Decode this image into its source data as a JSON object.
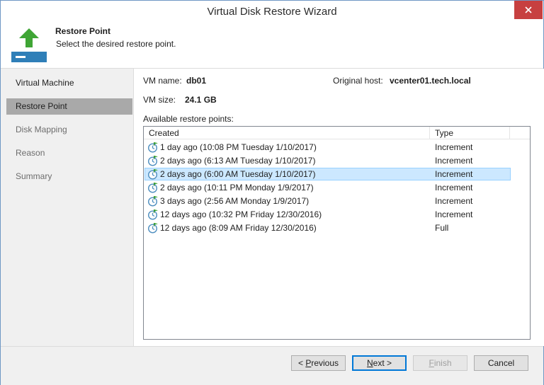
{
  "window": {
    "title": "Virtual Disk Restore Wizard"
  },
  "header": {
    "title": "Restore Point",
    "subtitle": "Select the desired restore point.",
    "icon": "restore-arrow-icon"
  },
  "steps": [
    {
      "label": "Virtual Machine",
      "state": "done"
    },
    {
      "label": "Restore Point",
      "state": "active"
    },
    {
      "label": "Disk Mapping",
      "state": "pending"
    },
    {
      "label": "Reason",
      "state": "pending"
    },
    {
      "label": "Summary",
      "state": "pending"
    }
  ],
  "vm": {
    "name_label": "VM name:",
    "name_value": "db01",
    "host_label": "Original host:",
    "host_value": "vcenter01.tech.local",
    "size_label": "VM size:",
    "size_value": "24.1 GB"
  },
  "restore_points": {
    "label": "Available restore points:",
    "columns": {
      "created": "Created",
      "type": "Type"
    },
    "rows": [
      {
        "created": "1 day ago (10:08 PM Tuesday 1/10/2017)",
        "type": "Increment",
        "selected": false
      },
      {
        "created": "2 days ago (6:13 AM Tuesday 1/10/2017)",
        "type": "Increment",
        "selected": false
      },
      {
        "created": "2 days ago (6:00 AM Tuesday 1/10/2017)",
        "type": "Increment",
        "selected": true
      },
      {
        "created": "2 days ago (10:11 PM Monday 1/9/2017)",
        "type": "Increment",
        "selected": false
      },
      {
        "created": "3 days ago (2:56 AM Monday 1/9/2017)",
        "type": "Increment",
        "selected": false
      },
      {
        "created": "12 days ago (10:32 PM Friday 12/30/2016)",
        "type": "Increment",
        "selected": false
      },
      {
        "created": "12 days ago (8:09 AM Friday 12/30/2016)",
        "type": "Full",
        "selected": false
      }
    ]
  },
  "buttons": {
    "previous_prefix": "< ",
    "previous_key": "P",
    "previous_rest": "revious",
    "next_key": "N",
    "next_rest": "ext >",
    "finish_key": "F",
    "finish_rest": "inish",
    "cancel": "Cancel"
  },
  "colors": {
    "selected_row": "#cce8ff",
    "active_step": "#a9a9a9",
    "close_button": "#c74040",
    "arrow": "#3fa535"
  }
}
